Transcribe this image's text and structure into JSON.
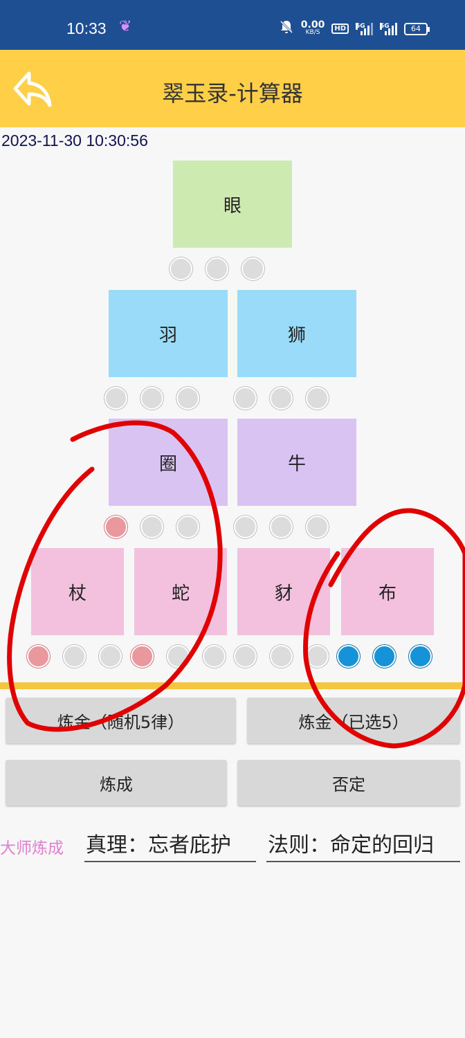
{
  "status_bar": {
    "time": "10:33",
    "net_speed_value": "0.00",
    "net_speed_unit": "KB/S",
    "hd_label": "HD",
    "sig1_label": "5G",
    "sig2_label": "5G",
    "battery": "64",
    "icons": [
      "butterfly-icon",
      "mute-bell-icon",
      "signal-icon",
      "battery-icon"
    ]
  },
  "app_bar": {
    "title": "翠玉录-计算器",
    "back_icon": "back-arrow-icon"
  },
  "datetime": "2023-11-30 10:30:56",
  "rows": [
    {
      "cards": [
        "眼"
      ],
      "color": "green"
    },
    {
      "cards": [
        "羽",
        "狮"
      ],
      "color": "blue"
    },
    {
      "cards": [
        "圈",
        "牛"
      ],
      "color": "purple"
    },
    {
      "cards": [
        "杖",
        "蛇",
        "豺",
        "布"
      ],
      "color": "pink"
    }
  ],
  "dot_states": {
    "row1": [
      "off",
      "off",
      "off"
    ],
    "row2": [
      "off",
      "off",
      "off",
      "off",
      "off",
      "off"
    ],
    "row3": [
      "red",
      "off",
      "off",
      "off",
      "off",
      "off"
    ],
    "row4": [
      "red",
      "off",
      "off",
      "red",
      "off",
      "off",
      "off",
      "off",
      "off",
      "sel",
      "sel",
      "sel"
    ]
  },
  "buttons": {
    "alchemy_random": "炼金（随机5律）",
    "alchemy_selected": "炼金（已选5）",
    "refine": "炼成",
    "deny": "否定"
  },
  "result": {
    "master_label": "大师炼成",
    "truth": "真理：忘者庇护",
    "law": "法则：命定的回归"
  },
  "colors": {
    "status_bar": "#1e4f93",
    "app_bar": "#ffcf47",
    "card_green": "#cdeab0",
    "card_blue": "#99dbf8",
    "card_purple": "#d9c3f3",
    "card_pink": "#f3c1dd",
    "dot_selected": "#1693d8",
    "dot_red": "#e9999d",
    "annotation": "#e00000"
  }
}
